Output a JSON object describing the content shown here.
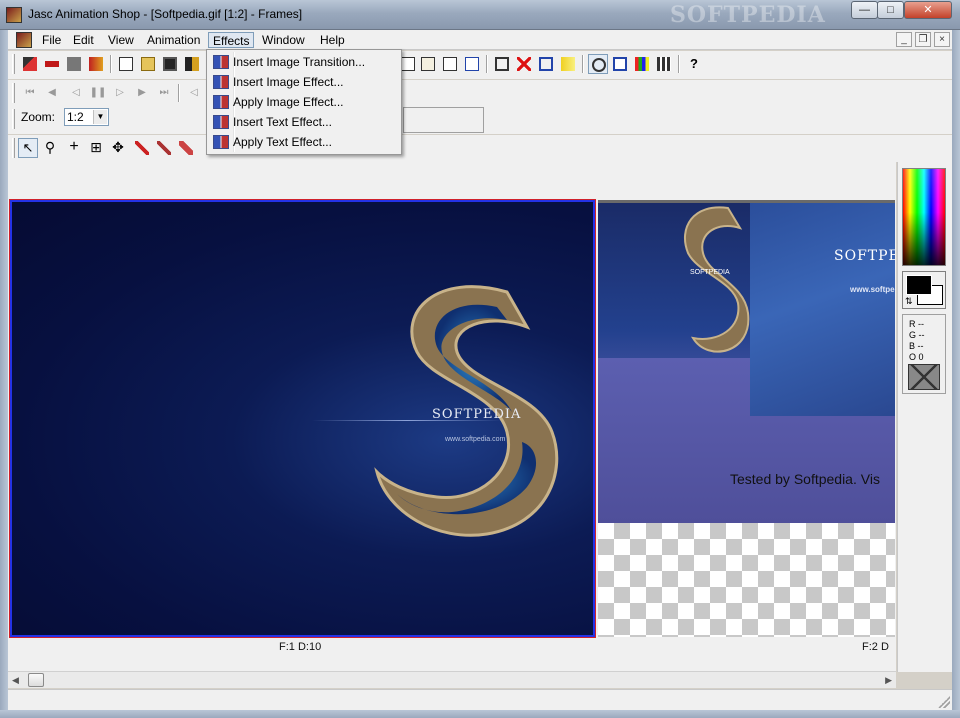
{
  "window": {
    "title": "Jasc Animation Shop - [Softpedia.gif [1:2] - Frames]",
    "watermark": "SOFTPEDIA"
  },
  "menubar": {
    "items": [
      "File",
      "Edit",
      "View",
      "Animation",
      "Effects",
      "Window",
      "Help"
    ],
    "active": "Effects"
  },
  "effects_menu": {
    "items": [
      "Insert Image Transition...",
      "Insert Image Effect...",
      "Apply Image Effect...",
      "Insert Text Effect...",
      "Apply Text Effect..."
    ]
  },
  "zoom": {
    "label": "Zoom:",
    "value": "1:2"
  },
  "frames": [
    {
      "caption": "F:1  D:10",
      "logo_text": "SOFTPEDIA",
      "url_text": "www.softpedia.com"
    },
    {
      "caption": "F:2  D",
      "logo_text": "SOFTPE",
      "url_text": "www.softpe",
      "tested_text": "Tested by Softpedia. Vis",
      "small_text": "SOFTPEDIA"
    }
  ],
  "color_panel": {
    "r": "R --",
    "g": "G --",
    "b": "B --",
    "o": "O 0"
  },
  "icons": {
    "app": "animation-shop-icon",
    "close": "close-icon",
    "maximize": "maximize-icon",
    "minimize": "minimize-icon"
  },
  "colors": {
    "frame_selection": "#2432e6",
    "frame_bg": "#071040",
    "menu_highlight": "#dfe7f1"
  }
}
